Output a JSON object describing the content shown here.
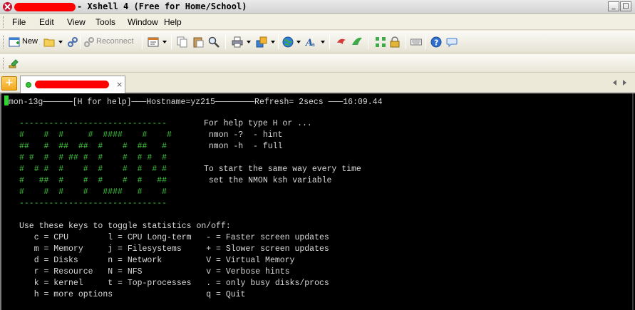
{
  "window": {
    "title": "- Xshell 4 (Free for Home/School)",
    "controls": {
      "minimize": "_",
      "maximize": "□",
      "close": "×"
    }
  },
  "menubar": [
    "File",
    "Edit",
    "View",
    "Tools",
    "Window",
    "Help"
  ],
  "toolbar": {
    "new_label": "New",
    "reconnect_label": "Reconnect"
  },
  "tabbar": {
    "add_tab": "+",
    "session_close": "×"
  },
  "terminal": {
    "header": "mon-13g──────[H for help]───Hostname=yz215────────Refresh= 2secs ───16:09.44",
    "banner_rule": "------------------------------",
    "banner_lines": [
      "#    #  #     #  ####    #    #",
      "##   #  ##  ##  #    #  ##   #",
      "# #  #  # ## #  #    #  # #  #",
      "#  # #  #    #  #    #  #  # #",
      "#   ##  #    #  #    #  #   ##",
      "#    #  #    #   ####   #    #"
    ],
    "help_lines": [
      "For help type H or ...",
      " nmon -?  - hint",
      " nmon -h  - full",
      "",
      "To start the same way every time",
      " set the NMON ksh variable"
    ],
    "keys_title": "Use these keys to toggle statistics on/off:",
    "key_rows": [
      "   c = CPU        l = CPU Long-term   - = Faster screen updates",
      "   m = Memory     j = Filesystems     + = Slower screen updates",
      "   d = Disks      n = Network         V = Virtual Memory",
      "   r = Resource   N = NFS             v = Verbose hints",
      "   k = kernel     t = Top-processes   . = only busy disks/procs",
      "   h = more options                   q = Quit"
    ]
  }
}
